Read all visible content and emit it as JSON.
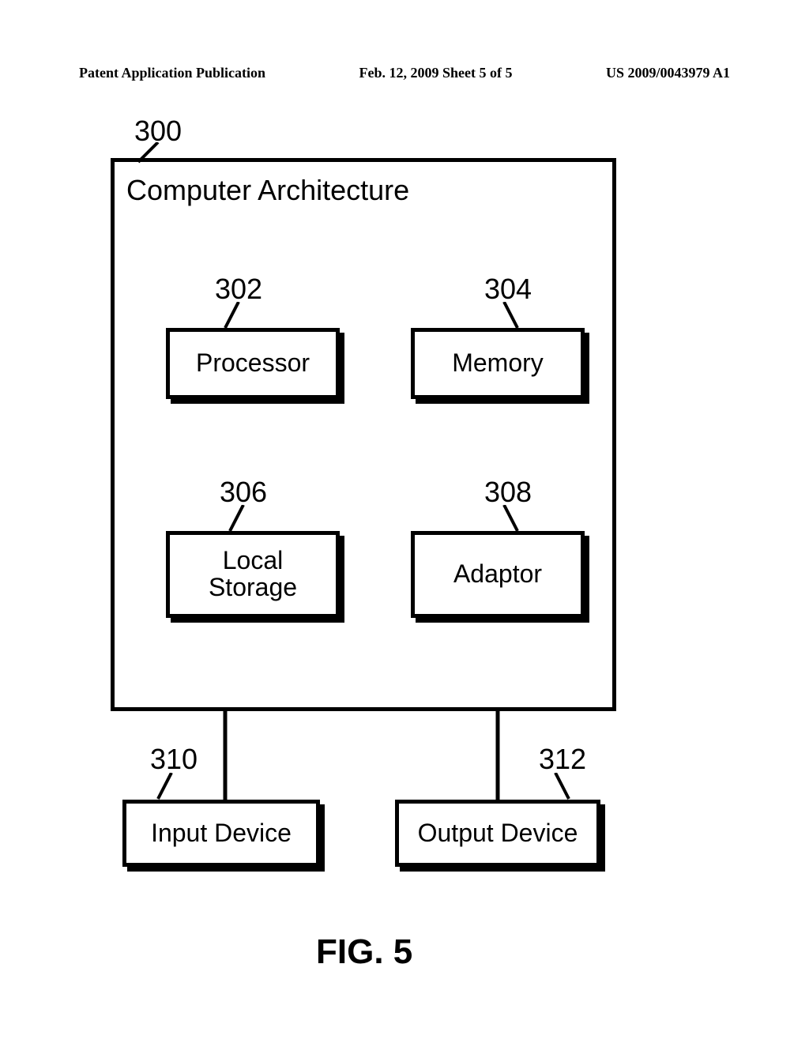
{
  "header": {
    "left": "Patent Application Publication",
    "center": "Feb. 12, 2009  Sheet 5 of 5",
    "right": "US 2009/0043979 A1"
  },
  "refs": {
    "main": "300",
    "processor": "302",
    "memory": "304",
    "storage": "306",
    "adaptor": "308",
    "input": "310",
    "output": "312"
  },
  "labels": {
    "main_title": "Computer Architecture",
    "processor": "Processor",
    "memory": "Memory",
    "storage": "Local\nStorage",
    "adaptor": "Adaptor",
    "input": "Input Device",
    "output": "Output Device",
    "figure": "FIG. 5"
  }
}
